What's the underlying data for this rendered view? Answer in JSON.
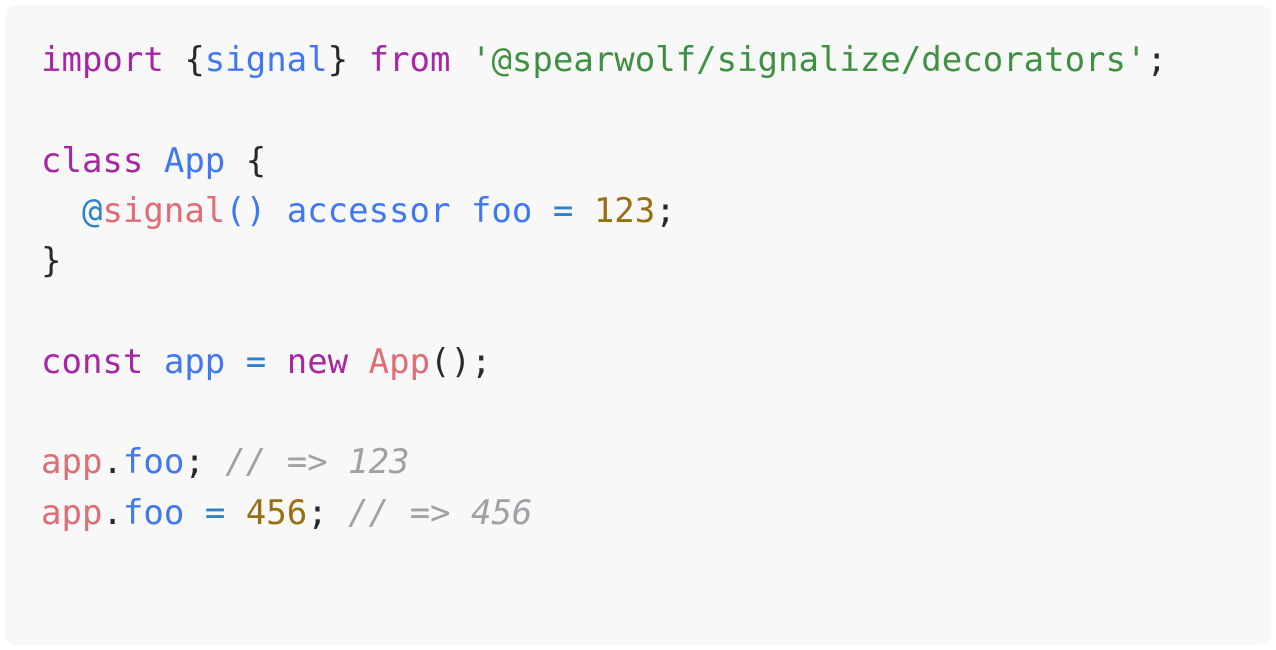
{
  "panel": {
    "background_color": "#f8f8f8",
    "frame_color": "#ffffff",
    "corner_radius_px": 11
  },
  "theme": {
    "name": "one-light",
    "default_text_color": "#24292e",
    "keyword_color": "#a626a4",
    "variable_color": "#4078f2",
    "string_color": "#3f9142",
    "class_color": "#e06c75",
    "decorator_color": "#e06c75",
    "at_symbol_color": "#2c81c9",
    "number_color": "#9a6e13",
    "operator_color": "#2c81c9",
    "comment_color": "#a0a1a7"
  },
  "code": {
    "language": "typescript",
    "plain_text": "import {signal} from '@spearwolf/signalize/decorators';\n\nclass App {\n  @signal() accessor foo = 123;\n}\n\nconst app = new App();\n\napp.foo; // => 123\napp.foo = 456; // => 456",
    "lines": [
      {
        "number": 1,
        "text": "import {signal} from '@spearwolf/signalize/decorators';",
        "tokens": [
          {
            "t": "import",
            "k": "keyword"
          },
          {
            "t": " ",
            "k": "plain"
          },
          {
            "t": "{",
            "k": "punct"
          },
          {
            "t": "signal",
            "k": "variable"
          },
          {
            "t": "}",
            "k": "punct"
          },
          {
            "t": " ",
            "k": "plain"
          },
          {
            "t": "from",
            "k": "keyword"
          },
          {
            "t": " ",
            "k": "plain"
          },
          {
            "t": "'@spearwolf/signalize/decorators'",
            "k": "string"
          },
          {
            "t": ";",
            "k": "punct"
          }
        ]
      },
      {
        "number": 2,
        "text": "",
        "tokens": []
      },
      {
        "number": 3,
        "text": "class App {",
        "tokens": [
          {
            "t": "class",
            "k": "keyword"
          },
          {
            "t": " ",
            "k": "plain"
          },
          {
            "t": "App",
            "k": "variable"
          },
          {
            "t": " ",
            "k": "plain"
          },
          {
            "t": "{",
            "k": "punct"
          }
        ]
      },
      {
        "number": 4,
        "text": "  @signal() accessor foo = 123;",
        "tokens": [
          {
            "t": "  ",
            "k": "plain"
          },
          {
            "t": "@",
            "k": "at"
          },
          {
            "t": "signal",
            "k": "decorator"
          },
          {
            "t": "()",
            "k": "variable"
          },
          {
            "t": " ",
            "k": "plain"
          },
          {
            "t": "accessor",
            "k": "variable"
          },
          {
            "t": " ",
            "k": "plain"
          },
          {
            "t": "foo",
            "k": "variable"
          },
          {
            "t": " ",
            "k": "plain"
          },
          {
            "t": "=",
            "k": "operator"
          },
          {
            "t": " ",
            "k": "plain"
          },
          {
            "t": "123",
            "k": "number"
          },
          {
            "t": ";",
            "k": "punct"
          }
        ]
      },
      {
        "number": 5,
        "text": "}",
        "tokens": [
          {
            "t": "}",
            "k": "punct"
          }
        ]
      },
      {
        "number": 6,
        "text": "",
        "tokens": []
      },
      {
        "number": 7,
        "text": "const app = new App();",
        "tokens": [
          {
            "t": "const",
            "k": "keyword"
          },
          {
            "t": " ",
            "k": "plain"
          },
          {
            "t": "app",
            "k": "variable"
          },
          {
            "t": " ",
            "k": "plain"
          },
          {
            "t": "=",
            "k": "operator"
          },
          {
            "t": " ",
            "k": "plain"
          },
          {
            "t": "new",
            "k": "keyword"
          },
          {
            "t": " ",
            "k": "plain"
          },
          {
            "t": "App",
            "k": "class"
          },
          {
            "t": "();",
            "k": "punct"
          }
        ]
      },
      {
        "number": 8,
        "text": "",
        "tokens": []
      },
      {
        "number": 9,
        "text": "app.foo; // => 123",
        "tokens": [
          {
            "t": "app",
            "k": "class"
          },
          {
            "t": ".",
            "k": "punct"
          },
          {
            "t": "foo",
            "k": "variable"
          },
          {
            "t": ";",
            "k": "punct"
          },
          {
            "t": " ",
            "k": "plain"
          },
          {
            "t": "// => 123",
            "k": "comment"
          }
        ]
      },
      {
        "number": 10,
        "text": "app.foo = 456; // => 456",
        "tokens": [
          {
            "t": "app",
            "k": "class"
          },
          {
            "t": ".",
            "k": "punct"
          },
          {
            "t": "foo",
            "k": "variable"
          },
          {
            "t": " ",
            "k": "plain"
          },
          {
            "t": "=",
            "k": "operator"
          },
          {
            "t": " ",
            "k": "plain"
          },
          {
            "t": "456",
            "k": "number"
          },
          {
            "t": ";",
            "k": "punct"
          },
          {
            "t": " ",
            "k": "plain"
          },
          {
            "t": "// => 456",
            "k": "comment"
          }
        ]
      }
    ]
  }
}
